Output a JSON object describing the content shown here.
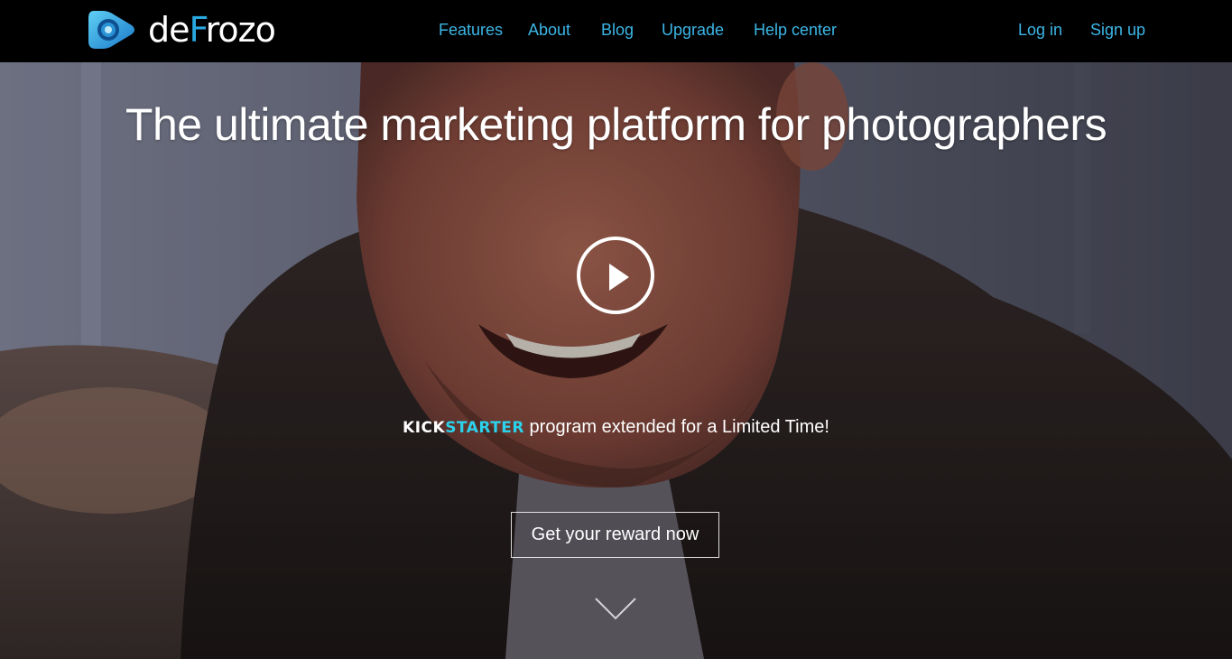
{
  "brand": {
    "name_prefix": "de",
    "name_accent": "F",
    "name_suffix": "rozo"
  },
  "nav": {
    "features": "Features",
    "about": "About",
    "blog": "Blog",
    "upgrade": "Upgrade",
    "help": "Help center",
    "login": "Log in",
    "signup": "Sign up"
  },
  "hero": {
    "headline": "The ultimate marketing platform for photographers",
    "play_icon": "play-circle-icon",
    "kickstarter_kick": "KICK",
    "kickstarter_starter": "STARTER",
    "promo_text": " program extended for a Limited Time!",
    "cta_label": "Get your reward now",
    "scroll_icon": "chevron-down-icon"
  },
  "colors": {
    "topbar": "#000000",
    "nav_link": "#3cb6e6",
    "brand_accent": "#29a8e0",
    "kickstarter_accent": "#2bd2ec"
  }
}
